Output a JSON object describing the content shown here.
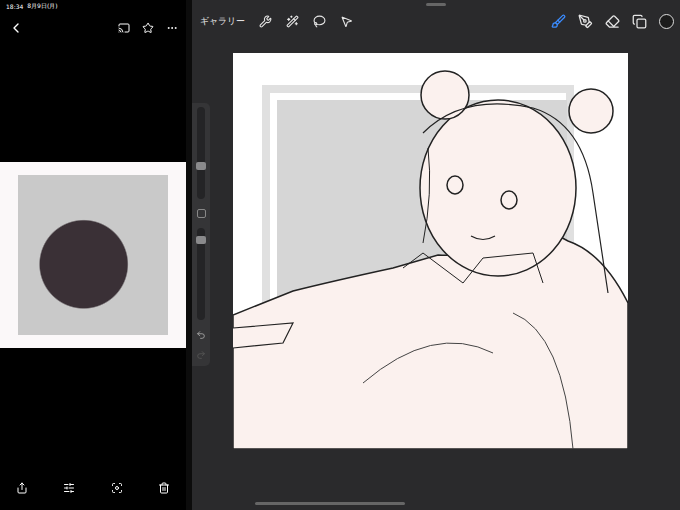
{
  "status_bar": {
    "time": "18:34",
    "date": "8月9日(月)"
  },
  "procreate": {
    "gallery": "ギャラリー",
    "tools": [
      {
        "kind": "brush",
        "selected": true
      },
      {
        "kind": "smudge",
        "selected": false
      },
      {
        "kind": "eraser",
        "selected": false
      },
      {
        "kind": "layers",
        "selected": false
      }
    ],
    "size_slider": {
      "level": 0.35
    },
    "opacity_slider": {
      "level": 0.9
    },
    "undo": {
      "disabled": false
    },
    "redo": {
      "disabled": true
    }
  }
}
